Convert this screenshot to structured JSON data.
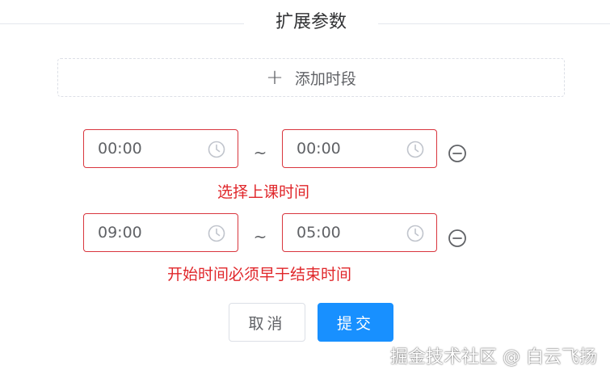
{
  "section": {
    "title": "扩展参数"
  },
  "add_period": {
    "icon": "plus-icon",
    "label": "添加时段"
  },
  "periods": [
    {
      "start": "00:00",
      "separator": "~",
      "end": "00:00",
      "error": "选择上课时间"
    },
    {
      "start": "09:00",
      "separator": "~",
      "end": "05:00",
      "error": "开始时间必须早于结束时间"
    }
  ],
  "actions": {
    "cancel_label": "取消",
    "submit_label": "提交"
  },
  "watermark": "掘金技术社区 @ 白云飞扬",
  "colors": {
    "error": "#e0262a",
    "primary": "#1890ff",
    "border_error": "#d9363e"
  }
}
